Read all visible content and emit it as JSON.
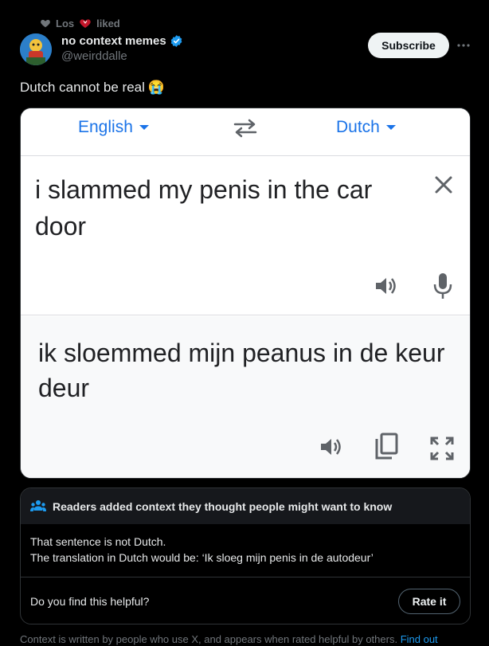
{
  "social_context": {
    "name": "Los",
    "action": "liked"
  },
  "author": {
    "name": "no context memes",
    "handle": "@weirddalle"
  },
  "subscribe_label": "Subscribe",
  "tweet": {
    "text": "Dutch cannot be real",
    "emoji": "😭"
  },
  "media": {
    "source_lang": "English",
    "target_lang": "Dutch",
    "source_text": "i slammed my penis in the car door",
    "translated_text": "ik sloemmed mijn peanus in de keur deur"
  },
  "community_note": {
    "heading": "Readers added context they thought people might want to know",
    "line1": "That sentence is not Dutch.",
    "line2": "The translation in Dutch would be: ‘Ik sloeg mijn penis in de autodeur’",
    "question": "Do you find this helpful?",
    "rate_label": "Rate it"
  },
  "disclaimer": {
    "text": "Context is written by people who use X, and appears when rated helpful by others.",
    "link": "Find out"
  },
  "colors": {
    "accent": "#1d9bf0",
    "google_blue": "#1a73e8",
    "background": "#000000"
  },
  "icons": [
    "heart-icon",
    "red-heart-icon",
    "verified-badge-icon",
    "more-icon",
    "swap-icon",
    "clear-icon",
    "speaker-icon",
    "mic-icon",
    "copy-icon",
    "expand-icon",
    "people-icon"
  ]
}
